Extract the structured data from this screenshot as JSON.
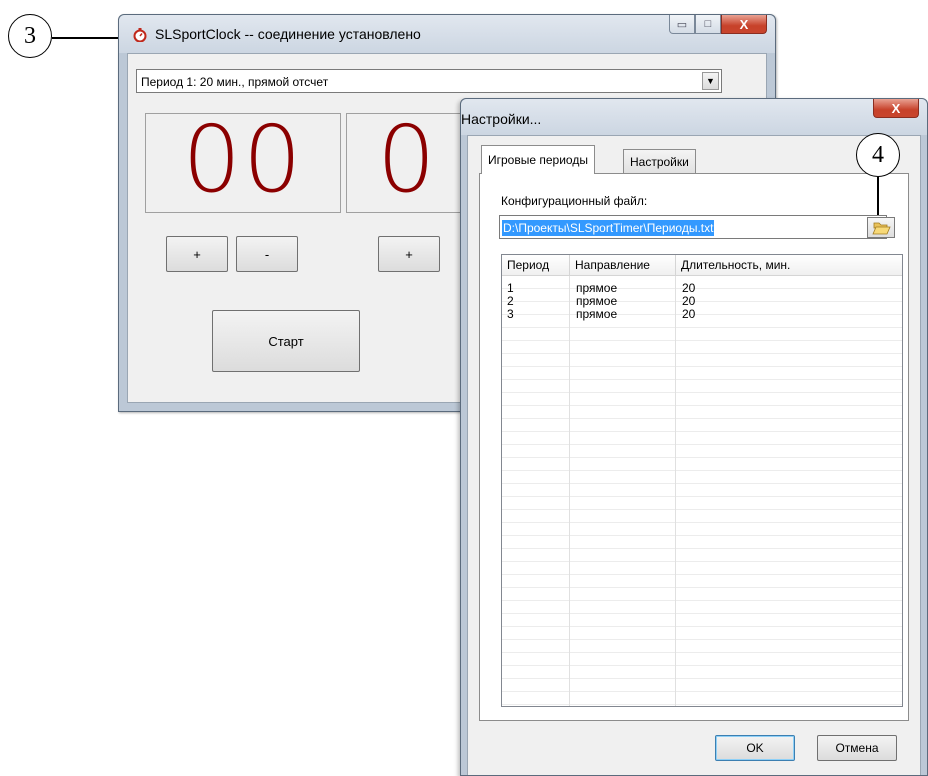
{
  "callouts": {
    "main": "3",
    "file": "4"
  },
  "main_window": {
    "title": "SLSportClock -- соединение установлено",
    "controls": {
      "minimize": "▭",
      "maximize": "□",
      "close": "X"
    },
    "period_select": "Период 1: 20 мин., прямой отсчет",
    "minutes": "00",
    "seconds": "0",
    "plus_label": "+",
    "minus_label": "-",
    "start_label": "Старт"
  },
  "settings_dialog": {
    "title": "Настройки...",
    "close": "X",
    "tabs": [
      "Игровые периоды",
      "Настройки"
    ],
    "config_label": "Конфигурационный файл:",
    "config_path": "D:\\Проекты\\SLSportTimer\\Периоды.txt",
    "table": {
      "columns": [
        "Период",
        "Направление",
        "Длительность, мин."
      ],
      "rows": [
        [
          "1",
          "прямое",
          "20"
        ],
        [
          "2",
          "прямое",
          "20"
        ],
        [
          "3",
          "прямое",
          "20"
        ]
      ]
    },
    "ok_label": "OK",
    "cancel_label": "Отмена"
  },
  "colors": {
    "digits": "#8b0000",
    "selection": "#3399ff",
    "close_button": "#c7412a"
  },
  "icons": [
    "stopwatch-icon",
    "folder-open-icon",
    "dropdown-arrow-icon"
  ]
}
